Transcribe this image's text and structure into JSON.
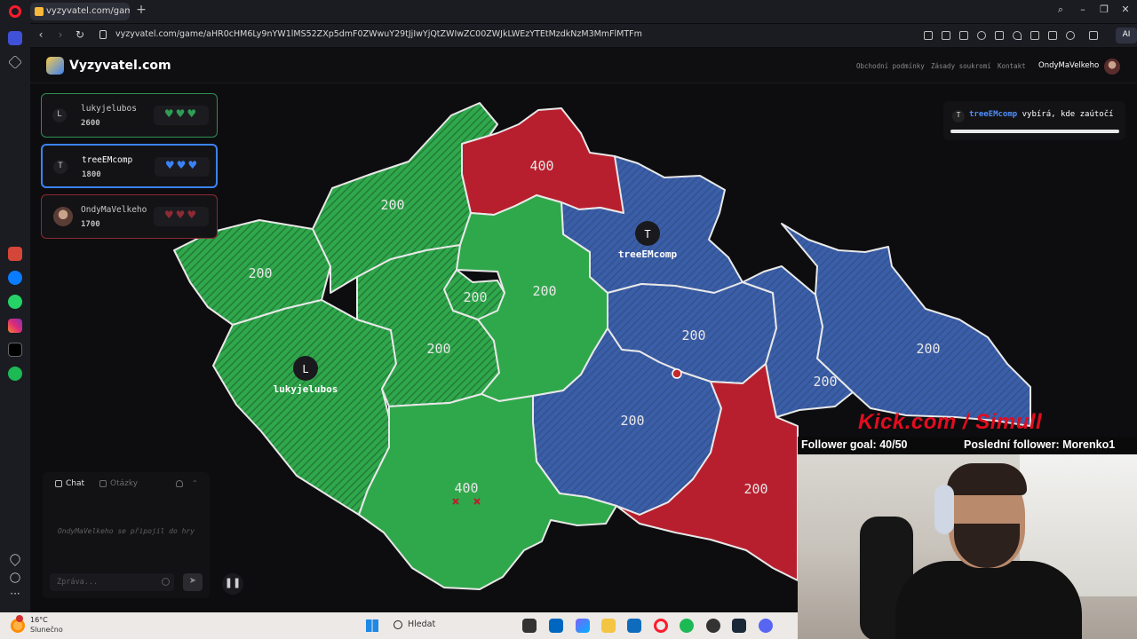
{
  "browser": {
    "tab_title": "vyzyvatel.com/game/aHR",
    "url": "vyzyvatel.com/game/aHR0cHM6Ly9nYW1lMS52ZXp5dmF0ZWwuY29tJjIwYjQtZWIwZC00ZWJkLWEzYTEtMzdkNzM3MmFlMTFm",
    "ai_label": "AI",
    "icons": [
      "back-icon",
      "forward-icon",
      "reload-icon",
      "lock-icon",
      "search-icon",
      "minimize-icon",
      "maximize-icon",
      "close-icon"
    ]
  },
  "site": {
    "logo_text": "Vyzyvatel.com",
    "nav_links": [
      "Obchodní podmínky",
      "Zásady soukromí",
      "Kontakt"
    ],
    "username": "OndyMaVelkeho"
  },
  "players": [
    {
      "initial": "L",
      "name": "lukyjelubos",
      "score": "2600",
      "hearts": "♥♥♥",
      "color": "#2f9e55"
    },
    {
      "initial": "T",
      "name": "treeEMcomp",
      "score": "1800",
      "hearts": "♥♥♥",
      "color": "#3b82f6"
    },
    {
      "initial": "",
      "name": "OndyMaVelkeho",
      "score": "1700",
      "hearts": "♥♥♥",
      "color": "#8d2a35"
    }
  ],
  "status": {
    "initial": "T",
    "player_name": "treeEMcomp",
    "message": "vybírá, kde zaútočí",
    "progress": 1.0
  },
  "map": {
    "colors": {
      "green": "#2fa84b",
      "blue": "#3b5ea8",
      "red": "#b81f2e",
      "border": "#e8e8e8"
    },
    "regions": [
      {
        "owner": "green",
        "hatched": true,
        "value": "200"
      },
      {
        "owner": "green",
        "hatched": true,
        "value": "200"
      },
      {
        "owner": "red",
        "hatched": false,
        "value": "400"
      },
      {
        "owner": "blue",
        "hatched": true,
        "value": ""
      },
      {
        "owner": "blue",
        "hatched": true,
        "value": "200"
      },
      {
        "owner": "green",
        "hatched": true,
        "value": "200"
      },
      {
        "owner": "green",
        "hatched": true,
        "value": "200"
      },
      {
        "owner": "green",
        "hatched": false,
        "value": "200"
      },
      {
        "owner": "blue",
        "hatched": true,
        "value": "200"
      },
      {
        "owner": "green",
        "hatched": true,
        "value": ""
      },
      {
        "owner": "blue",
        "hatched": true,
        "value": "200"
      },
      {
        "owner": "blue",
        "hatched": true,
        "value": "200"
      },
      {
        "owner": "green",
        "hatched": false,
        "value": "400"
      },
      {
        "owner": "red",
        "hatched": false,
        "value": "200"
      }
    ],
    "markers": [
      {
        "letter": "T",
        "name": "treeEMcomp"
      },
      {
        "letter": "L",
        "name": "lukyjelubos"
      }
    ]
  },
  "chat": {
    "tab_chat": "Chat",
    "tab_questions": "Otázky",
    "message": "OndyMaVelkeho se připojil do hry",
    "placeholder": "Zpráva..."
  },
  "stream_overlay": {
    "banner": "Kick.com / Simull",
    "follower_goal": "Follower goal: 40/50",
    "last_follower": "Poslední follower: Morenko1"
  },
  "taskbar": {
    "temperature": "16°C",
    "weather": "Slunečno",
    "search_label": "Hledat"
  }
}
